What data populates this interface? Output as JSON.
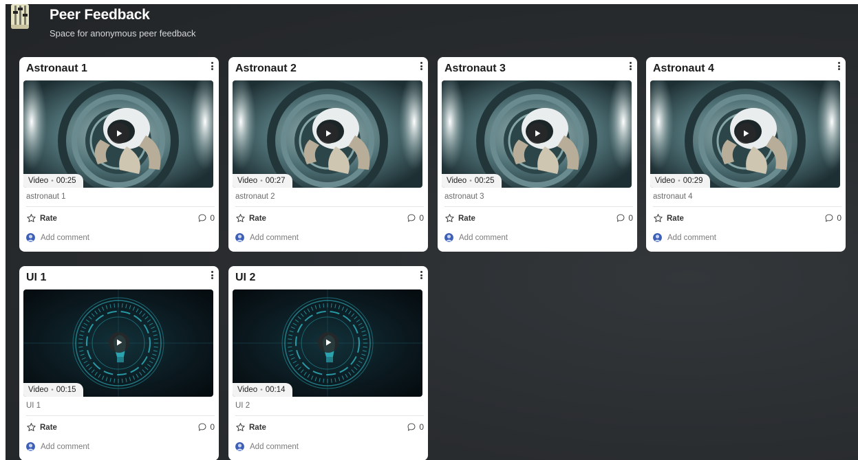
{
  "board": {
    "title": "Peer Feedback",
    "subtitle": "Space for anonymous peer feedback"
  },
  "labels": {
    "rate": "Rate",
    "add_comment": "Add comment",
    "video": "Video",
    "separator": "•"
  },
  "cards": [
    {
      "title": "Astronaut 1",
      "duration": "00:25",
      "filename": "astronaut 1",
      "comments": "0",
      "thumbnail": "astronaut"
    },
    {
      "title": "Astronaut 2",
      "duration": "00:27",
      "filename": "astronaut 2",
      "comments": "0",
      "thumbnail": "astronaut"
    },
    {
      "title": "Astronaut 3",
      "duration": "00:25",
      "filename": "astronaut 3",
      "comments": "0",
      "thumbnail": "astronaut"
    },
    {
      "title": "Astronaut 4",
      "duration": "00:29",
      "filename": "astronaut 4",
      "comments": "0",
      "thumbnail": "astronaut"
    },
    {
      "title": "UI 1",
      "duration": "00:15",
      "filename": "UI 1",
      "comments": "0",
      "thumbnail": "hud"
    },
    {
      "title": "UI 2",
      "duration": "00:14",
      "filename": "UI 2",
      "comments": "0",
      "thumbnail": "hud"
    }
  ],
  "colors": {
    "board_background": "#2a2d30",
    "card_background": "#ffffff",
    "hud_accent": "#2fb8c4",
    "astronaut_scene": "#4d6f74"
  },
  "icons": {
    "board_logo": "mixer-slider-icon",
    "menu": "kebab-menu-icon",
    "play": "play-icon",
    "rate": "star-outline-icon",
    "comments": "speech-bubble-icon",
    "avatar": "user-avatar"
  }
}
